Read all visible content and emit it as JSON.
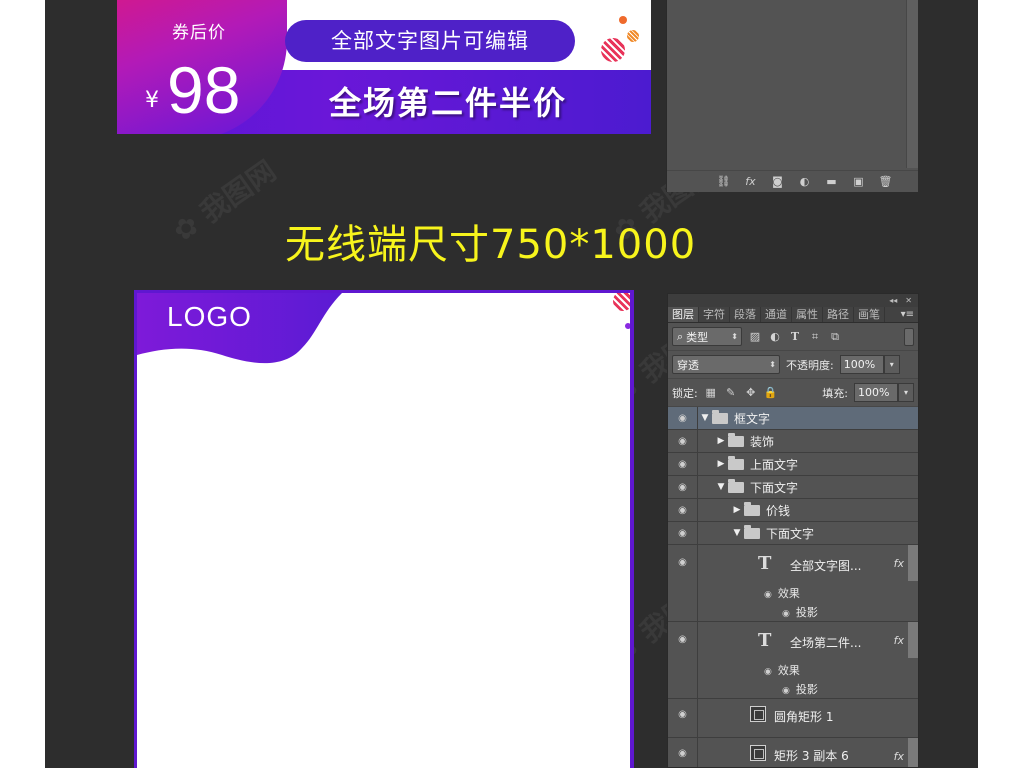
{
  "banner": {
    "coupon_label": "券后价",
    "currency": "¥",
    "price": "98",
    "pill_text": "全部文字图片可编辑",
    "main_text": "全场第二件半价"
  },
  "section_title": "无线端尺寸750*1000",
  "frame": {
    "logo": "LOGO"
  },
  "top_panel_footer": {
    "icons": [
      "link-icon",
      "fx-icon",
      "mask-icon",
      "adjustment-icon",
      "folder-icon",
      "new-layer-icon",
      "trash-icon"
    ]
  },
  "layers_panel": {
    "tabs": [
      "图层",
      "字符",
      "段落",
      "通道",
      "属性",
      "路径",
      "画笔"
    ],
    "filter_label": "类型",
    "blend_mode": "穿透",
    "opacity_label": "不透明度:",
    "opacity_value": "100%",
    "lock_label": "锁定:",
    "fill_label": "填充:",
    "fill_value": "100%",
    "layers": [
      {
        "name": "框文字"
      },
      {
        "name": "装饰"
      },
      {
        "name": "上面文字"
      },
      {
        "name": "下面文字"
      },
      {
        "name": "价钱"
      },
      {
        "name": "下面文字"
      },
      {
        "name": "全部文字图...",
        "effects": "效果",
        "sub": "投影"
      },
      {
        "name": "全场第二件...",
        "effects": "效果",
        "sub": "投影"
      },
      {
        "name": "圆角矩形 1"
      },
      {
        "name": "矩形 3 副本 6"
      }
    ],
    "fx_label": "fx"
  },
  "colors": {
    "accent_purple": "#5f17d0",
    "title_yellow": "#f7f41c",
    "panel_bg": "#535353"
  }
}
